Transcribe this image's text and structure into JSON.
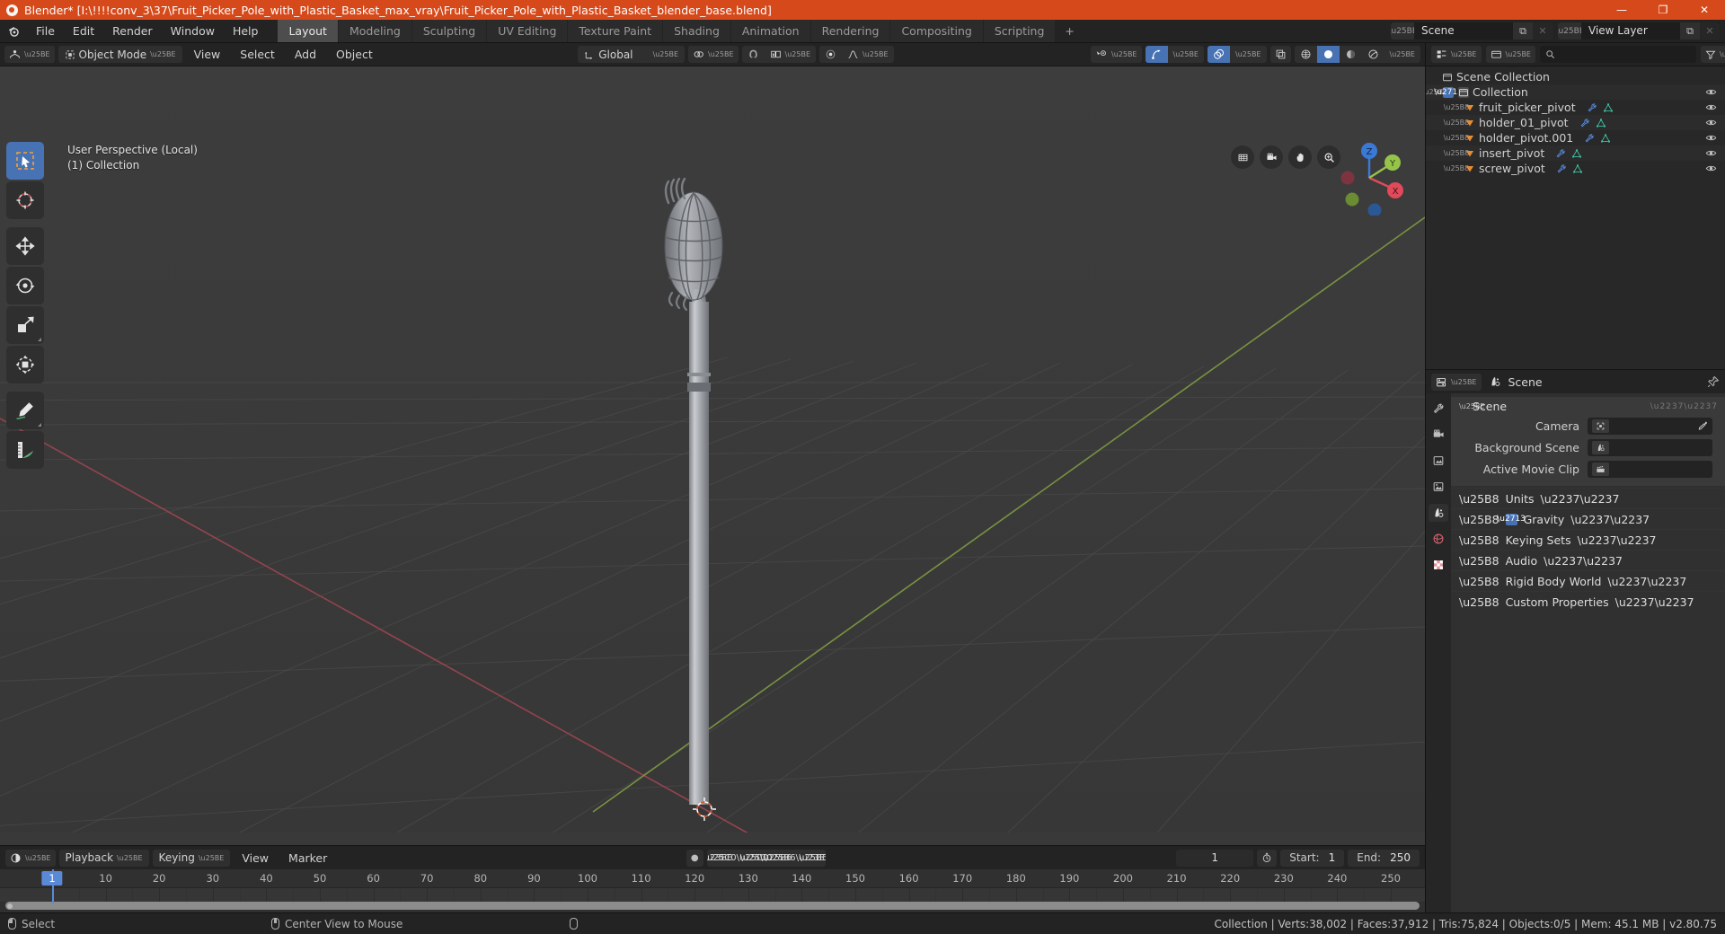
{
  "titlebar": {
    "text": "Blender* [I:\\!!!!conv_3\\37\\Fruit_Picker_Pole_with_Plastic_Basket_max_vray\\Fruit_Picker_Pole_with_Plastic_Basket_blender_base.blend]",
    "minimize": "—",
    "maximize": "❐",
    "close": "✕"
  },
  "topbar": {
    "menus": [
      "File",
      "Edit",
      "Render",
      "Window",
      "Help"
    ],
    "workspaces": [
      {
        "label": "Layout",
        "active": true
      },
      {
        "label": "Modeling",
        "active": false
      },
      {
        "label": "Sculpting",
        "active": false
      },
      {
        "label": "UV Editing",
        "active": false
      },
      {
        "label": "Texture Paint",
        "active": false
      },
      {
        "label": "Shading",
        "active": false
      },
      {
        "label": "Animation",
        "active": false
      },
      {
        "label": "Rendering",
        "active": false
      },
      {
        "label": "Compositing",
        "active": false
      },
      {
        "label": "Scripting",
        "active": false
      }
    ],
    "add_workspace": "+",
    "scene_name": "Scene",
    "view_layer_name": "View Layer",
    "new_btn": "⧉",
    "unlink_btn": "✕"
  },
  "viewport_header": {
    "editor_type": "editor-type-3dview",
    "mode": "Object Mode",
    "menus": [
      "View",
      "Select",
      "Add",
      "Object"
    ],
    "transform_orientation": "Global",
    "pivot": "pivot-point-icon",
    "snap": "snap-magnet-icon",
    "snap_to": "snap-increment-icon",
    "proportional": "proportional-editing-icon",
    "falloff": "falloff-smooth-icon",
    "visibility": "show-hide-icon",
    "gizmo": "gizmo-icon",
    "overlays": "overlays-icon",
    "xray": "xray-toggle-icon",
    "shading_modes": [
      "wireframe",
      "solid",
      "material",
      "rendered"
    ],
    "shading_active": "solid"
  },
  "viewport": {
    "perspective_label": "User Perspective (Local)",
    "collection_label": "(1) Collection",
    "tools": [
      {
        "name": "tweak-select-box",
        "active": true
      },
      {
        "name": "cursor",
        "active": false
      },
      {
        "name": "move",
        "active": false
      },
      {
        "name": "rotate",
        "active": false
      },
      {
        "name": "scale",
        "active": false
      },
      {
        "name": "transform",
        "active": false
      },
      {
        "name": "annotate",
        "active": false
      },
      {
        "name": "measure",
        "active": false
      }
    ],
    "gizmo_axes": [
      "Z",
      "Y",
      "X"
    ],
    "nav_buttons": [
      "zoom-grid",
      "camera",
      "pan-hand",
      "zoom-magnifier"
    ]
  },
  "timeline": {
    "editor_type": "editor-type-timeline",
    "menus": [
      "Playback",
      "Keying",
      "View",
      "Marker"
    ],
    "record_label": "●",
    "playback_buttons": [
      "jump-start",
      "prev-keyframe",
      "play-reverse",
      "play",
      "next-keyframe",
      "jump-end"
    ],
    "current_frame": "1",
    "autokey_icon": "auto-keyframe-icon",
    "start_label": "Start:",
    "start_value": "1",
    "end_label": "End:",
    "end_value": "250",
    "ruler_ticks": [
      "1",
      "10",
      "20",
      "30",
      "40",
      "50",
      "60",
      "70",
      "80",
      "90",
      "100",
      "110",
      "120",
      "130",
      "140",
      "150",
      "160",
      "170",
      "180",
      "190",
      "200",
      "210",
      "220",
      "230",
      "240",
      "250"
    ],
    "playhead_frame": "1"
  },
  "outliner": {
    "display_mode": "View Layer",
    "search_placeholder": "",
    "filter_icon": "filter-icon",
    "new_collection_icon": "new-collection-icon",
    "root": "Scene Collection",
    "collection": "Collection",
    "items": [
      {
        "label": "fruit_picker_pivot",
        "mods": [
          "modifier-icon",
          "mesh-data-icon"
        ]
      },
      {
        "label": "holder_01_pivot",
        "mods": [
          "modifier-icon",
          "mesh-data-icon"
        ]
      },
      {
        "label": "holder_pivot.001",
        "mods": [
          "modifier-icon",
          "mesh-data-icon"
        ]
      },
      {
        "label": "insert_pivot",
        "mods": [
          "modifier-icon",
          "mesh-data-icon"
        ]
      },
      {
        "label": "screw_pivot",
        "mods": [
          "modifier-icon",
          "mesh-data-icon"
        ]
      }
    ]
  },
  "properties": {
    "editor_type": "editor-type-properties",
    "breadcrumb": "Scene",
    "pin_icon": "pin-icon",
    "tabs": [
      "tool",
      "render",
      "output",
      "view-layer",
      "scene",
      "world",
      "texture"
    ],
    "active_tab": "scene",
    "scene_panel": {
      "title": "Scene",
      "rows": [
        {
          "label": "Camera",
          "value": "",
          "icon": "camera-data-icon",
          "extra": "eyedropper-icon"
        },
        {
          "label": "Background Scene",
          "value": "",
          "icon": "scene-icon",
          "extra": ""
        },
        {
          "label": "Active Movie Clip",
          "value": "",
          "icon": "movie-clip-icon",
          "extra": ""
        }
      ]
    },
    "sections": [
      {
        "label": "Units",
        "checkbox": false
      },
      {
        "label": "Gravity",
        "checkbox": true
      },
      {
        "label": "Keying Sets",
        "checkbox": false
      },
      {
        "label": "Audio",
        "checkbox": false
      },
      {
        "label": "Rigid Body World",
        "checkbox": false
      },
      {
        "label": "Custom Properties",
        "checkbox": false
      }
    ]
  },
  "statusbar": {
    "hints": [
      {
        "mouse": "left",
        "label": "Select"
      },
      {
        "mouse": "middle",
        "label": "Center View to Mouse"
      },
      {
        "mouse": "right",
        "label": ""
      }
    ],
    "stats": "Collection | Verts:38,002 | Faces:37,912 | Tris:75,824 | Objects:0/5 | Mem: 45.1 MB | v2.80.75"
  },
  "colors": {
    "accent_orange": "#d6491a",
    "accent_blue": "#4772b3",
    "axis_x": "#e04a5a",
    "axis_y": "#96c44a",
    "axis_z": "#3a7ad6",
    "object_orange": "#e88c32"
  }
}
